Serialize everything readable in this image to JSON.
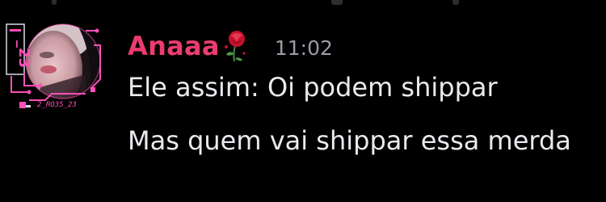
{
  "message": {
    "author": {
      "display_name": "Anaaa",
      "name_color": "#ec3c6f",
      "decoration_icon": "rose-icon"
    },
    "timestamp": "11:02",
    "lines": [
      "Ele assim: Oi podem shippar",
      "Mas quem vai shippar essa merda"
    ]
  },
  "avatar": {
    "frame_text": "_23",
    "frame_caption": "2_RO35_23",
    "accent": "#ff4fb8"
  },
  "colors": {
    "background": "#000000",
    "message_text": "#e9eaee",
    "timestamp": "#9a9ca5"
  }
}
